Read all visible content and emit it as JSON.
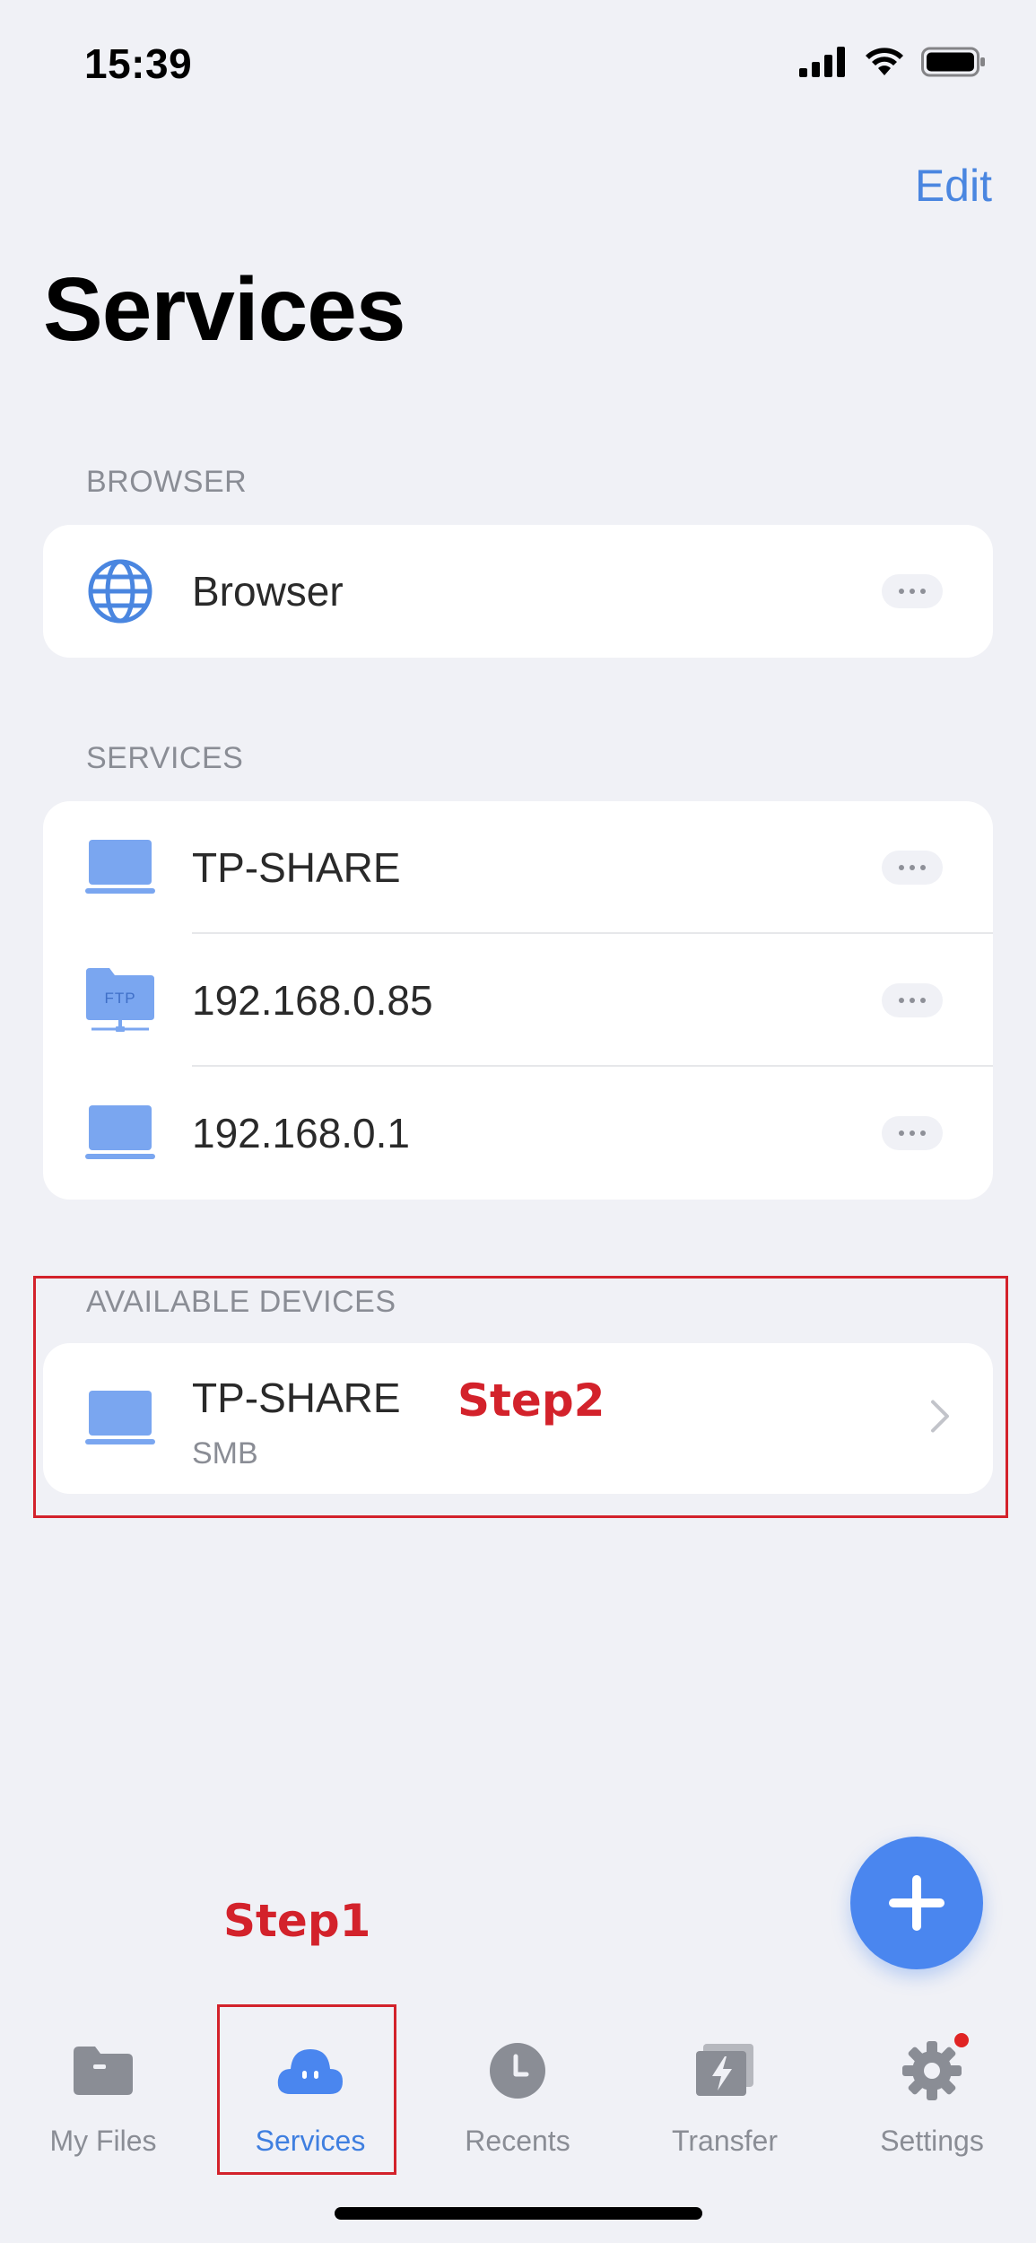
{
  "status_bar": {
    "time": "15:39"
  },
  "header": {
    "edit_label": "Edit",
    "title": "Services"
  },
  "browser_section": {
    "label": "BROWSER",
    "items": [
      {
        "label": "Browser",
        "icon": "globe-icon"
      }
    ]
  },
  "services_section": {
    "label": "SERVICES",
    "items": [
      {
        "label": "TP-SHARE",
        "icon": "laptop-icon"
      },
      {
        "label": "192.168.0.85",
        "icon": "ftp-folder-icon",
        "icon_text": "FTP"
      },
      {
        "label": "192.168.0.1",
        "icon": "laptop-icon"
      }
    ]
  },
  "devices_section": {
    "label": "AVAILABLE DEVICES",
    "items": [
      {
        "label": "TP-SHARE",
        "sublabel": "SMB",
        "icon": "laptop-icon"
      }
    ]
  },
  "annotations": {
    "step1": "Step1",
    "step2": "Step2"
  },
  "tabbar": {
    "tabs": [
      {
        "label": "My Files",
        "icon": "folder-icon",
        "active": false
      },
      {
        "label": "Services",
        "icon": "cloud-icon",
        "active": true
      },
      {
        "label": "Recents",
        "icon": "clock-icon",
        "active": false
      },
      {
        "label": "Transfer",
        "icon": "transfer-icon",
        "active": false
      },
      {
        "label": "Settings",
        "icon": "gear-icon",
        "active": false,
        "badge": true
      }
    ]
  },
  "colors": {
    "accent": "#4a86e0",
    "icon_blue": "#7aa6f0",
    "annotation_red": "#d3222b",
    "background": "#f0f1f6",
    "tab_inactive": "#8a8d95"
  }
}
